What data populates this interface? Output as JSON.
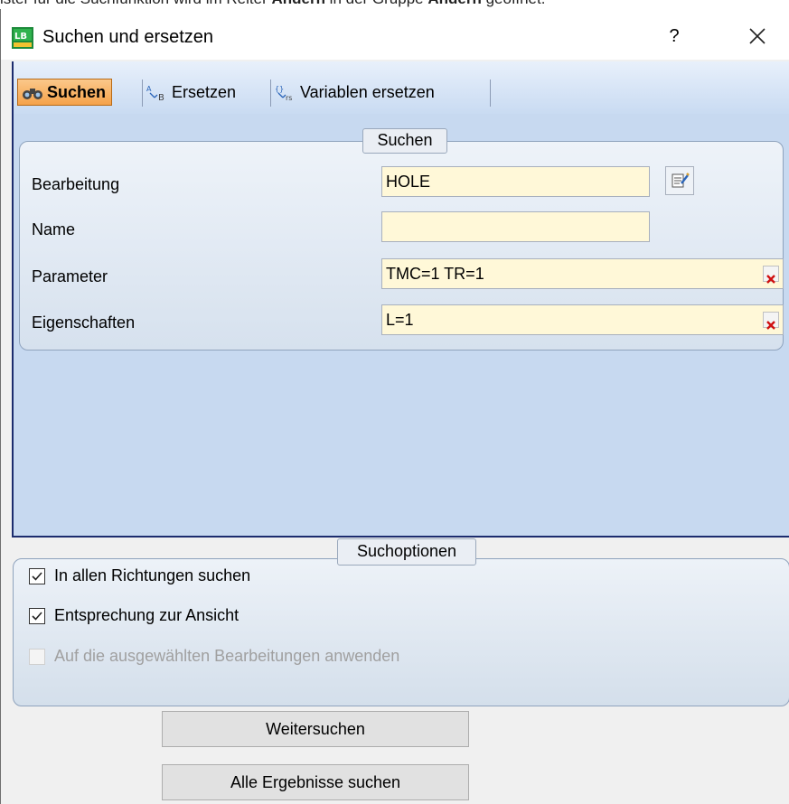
{
  "caption": {
    "before": "ister für die Suchfunktion wird im Reiter ",
    "bold1": "Ändern",
    "middle": " in der Gruppe ",
    "bold2": "Ändern",
    "after": " geöffnet."
  },
  "window": {
    "title": "Suchen und ersetzen",
    "help_label": "?"
  },
  "tabs": [
    {
      "label": "Suchen",
      "icon": "binoculars-icon",
      "active": true
    },
    {
      "label": "Ersetzen",
      "icon": "replace-icon",
      "active": false
    },
    {
      "label": "Variablen ersetzen",
      "icon": "replace-variables-icon",
      "active": false
    }
  ],
  "search_group": {
    "caption": "Suchen",
    "fields": [
      {
        "label": "Bearbeitung",
        "value": "HOLE"
      },
      {
        "label": "Name",
        "value": ""
      },
      {
        "label": "Parameter",
        "value": "TMC=1 TR=1"
      },
      {
        "label": "Eigenschaften",
        "value": "L=1"
      }
    ]
  },
  "options_group": {
    "caption": "Suchoptionen",
    "options": [
      {
        "label": "In allen Richtungen suchen",
        "checked": true,
        "enabled": true
      },
      {
        "label": "Entsprechung zur Ansicht",
        "checked": true,
        "enabled": true
      },
      {
        "label": "Auf die ausgewählten Bearbeitungen anwenden",
        "checked": false,
        "enabled": false
      }
    ]
  },
  "buttons": {
    "find_next": "Weitersuchen",
    "find_all": "Alle Ergebnisse suchen"
  },
  "colors": {
    "active_tab": "#f5a24a",
    "panel_bg": "#c7d9f0",
    "field_bg": "#fff8d8",
    "clear_x": "#d01010"
  }
}
